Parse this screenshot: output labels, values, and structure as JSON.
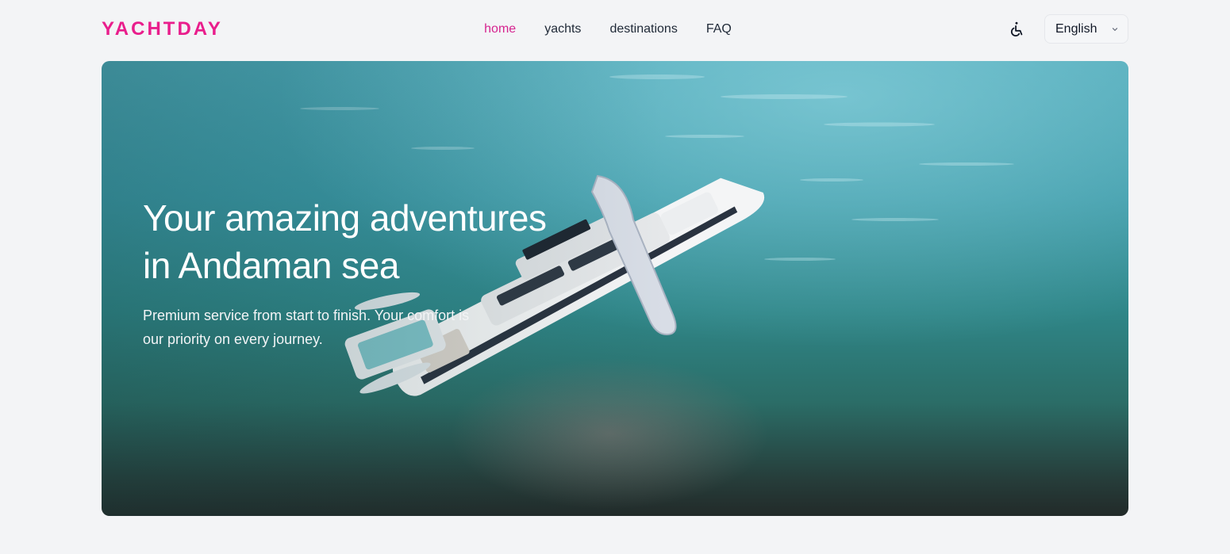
{
  "brand": {
    "logo_text": "YACHTDAY",
    "accent_color": "#e91e8c"
  },
  "nav": {
    "items": [
      {
        "label": "home",
        "active": true
      },
      {
        "label": "yachts",
        "active": false
      },
      {
        "label": "destinations",
        "active": false
      },
      {
        "label": "FAQ",
        "active": false
      }
    ]
  },
  "header": {
    "accessibility_icon": "wheelchair-icon",
    "language": {
      "selected": "English",
      "icon": "chevron-down-icon"
    }
  },
  "hero": {
    "title_line1": "Your amazing adventures",
    "title_line2": "in Andaman sea",
    "subtitle_line1": "Premium service from start to finish. Your comfort is",
    "subtitle_line2": "our priority on every journey."
  }
}
